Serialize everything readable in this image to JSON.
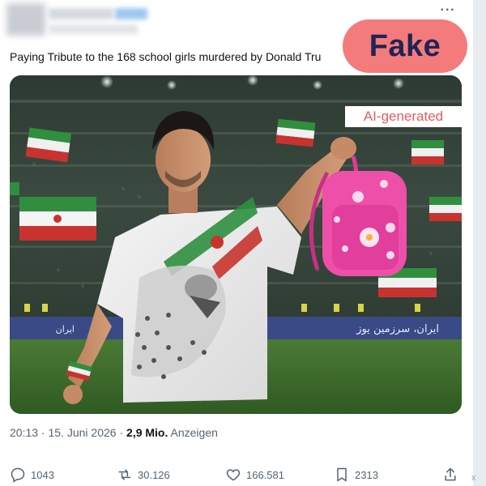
{
  "tweet": {
    "text": "Paying Tribute to the 168 school girls murdered by Donald Tru",
    "more_label": "···"
  },
  "badges": {
    "fake_label": "Fake",
    "ai_label": "AI-generated",
    "fake_color": "#f47b7b",
    "fake_text_color": "#1f2456",
    "ai_text_color": "#e35d5d"
  },
  "media": {
    "banner_text": "ایران، سرزمین یوز",
    "banner_text_left": "ایران"
  },
  "meta": {
    "time": "20:13",
    "separator1": " · ",
    "date": "15. Juni 2026",
    "separator2": " · ",
    "views": "2,9 Mio.",
    "views_label": " Anzeigen"
  },
  "actions": {
    "replies": "1043",
    "reposts": "30.126",
    "likes": "166.581",
    "bookmarks": "2313"
  },
  "icons": {
    "reply": "reply-icon",
    "repost": "repost-icon",
    "like": "heart-icon",
    "bookmark": "bookmark-icon",
    "share": "share-icon"
  },
  "watermark": "X"
}
